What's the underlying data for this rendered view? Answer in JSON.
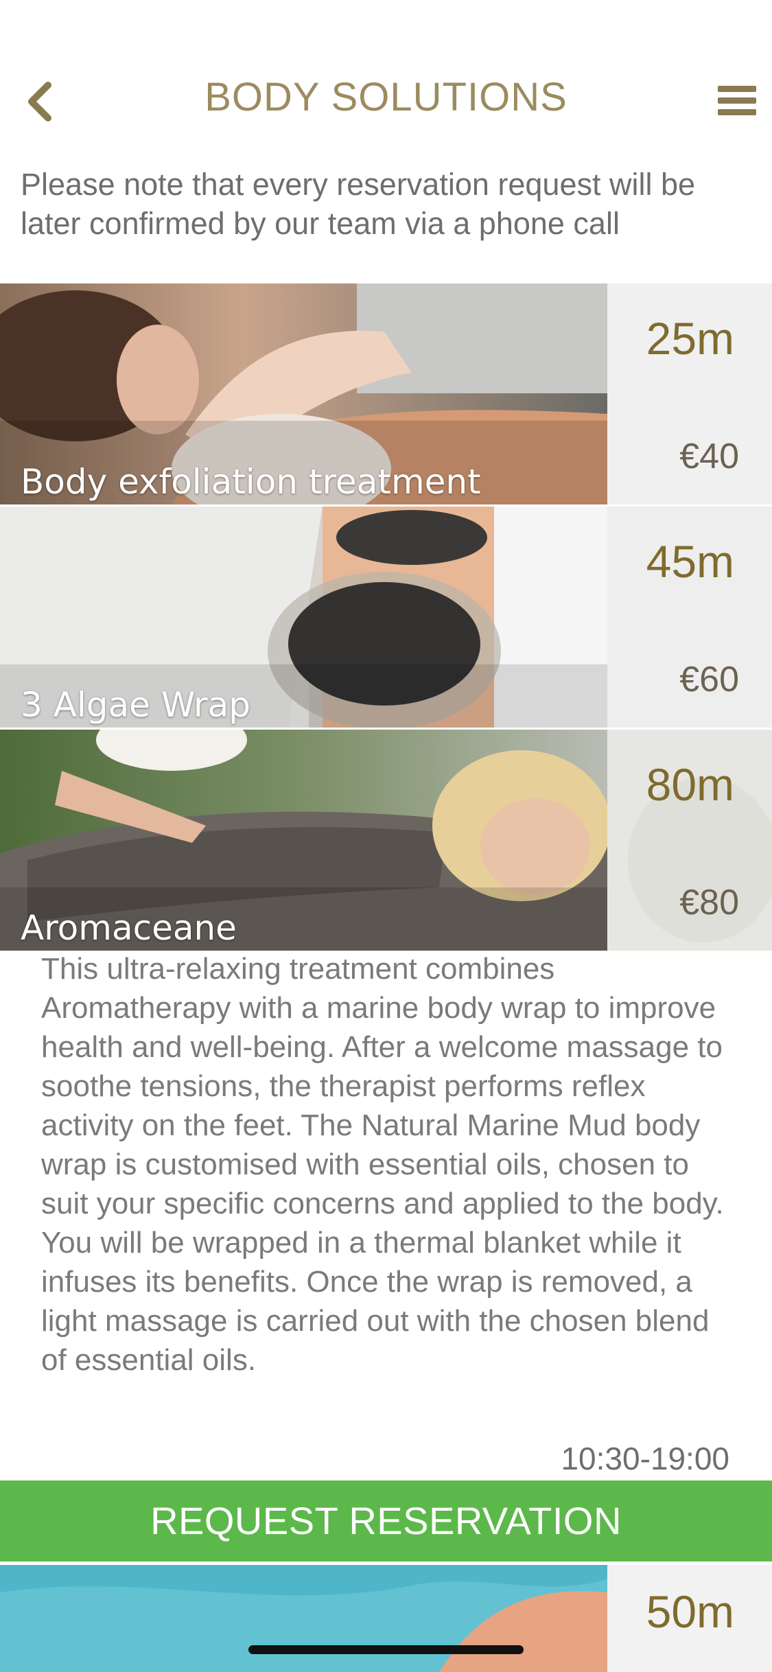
{
  "header": {
    "title": "BODY SOLUTIONS"
  },
  "note": "Please note that every reservation request will be later confirmed by our team via a phone call",
  "treatments": [
    {
      "name": "Body exfoliation treatment",
      "duration": "25m",
      "price": "€40"
    },
    {
      "name": "3 Algae Wrap",
      "duration": "45m",
      "price": "€60"
    },
    {
      "name": "Aromaceane",
      "duration": "80m",
      "price": "€80",
      "description": "This ultra-relaxing treatment combines Aromatherapy with a marine body wrap to improve health and well-being. After a welcome massage to soothe tensions, the therapist performs reflex activity on the feet. The Natural Marine Mud body wrap is customised with essential oils, chosen to suit your specific concerns and applied to the body. You will be wrapped in a thermal blanket while it infuses its benefits. Once the wrap is removed, a light massage is carried out with the chosen blend of essential oils.",
      "hours": "10:30-19:00",
      "reserve_label": "REQUEST RESERVATION"
    },
    {
      "name": "",
      "duration": "50m",
      "price": ""
    }
  ],
  "icons": [
    "chevron-left-icon",
    "hamburger-menu-icon"
  ],
  "colors": {
    "accent": "#9b8b5e",
    "duration": "#7f6b2d",
    "reserve": "#5cb84a"
  }
}
